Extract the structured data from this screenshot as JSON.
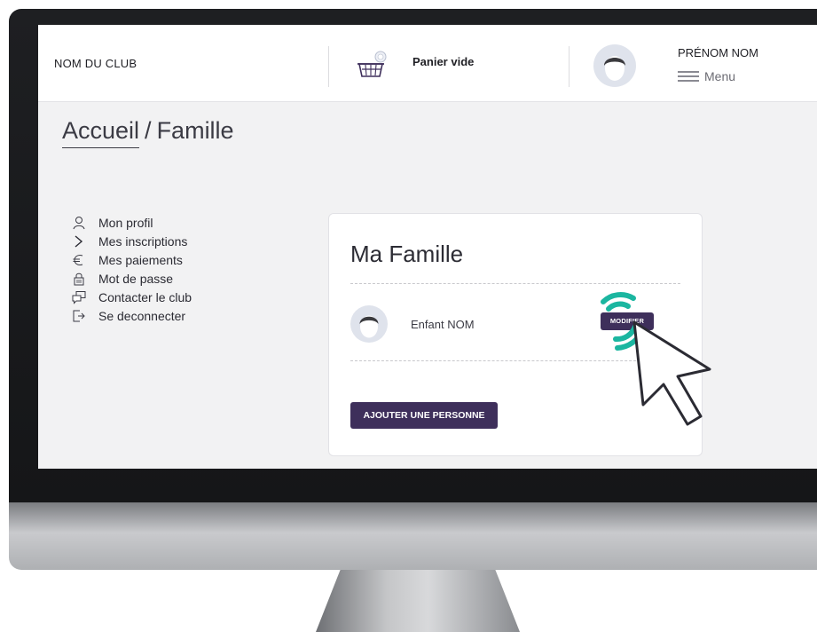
{
  "header": {
    "club_name": "NOM DU CLUB",
    "basket_label": "Panier vide",
    "user_name": "PRÉNOM NOM",
    "menu_label": "Menu"
  },
  "breadcrumb": {
    "home": "Accueil",
    "separator": "/",
    "current": "Famille"
  },
  "sidebar": {
    "items": [
      {
        "label": "Mon profil",
        "icon": "user-icon"
      },
      {
        "label": "Mes inscriptions",
        "icon": "chevron-right-icon"
      },
      {
        "label": "Mes paiements",
        "icon": "euro-icon"
      },
      {
        "label": "Mot de passe",
        "icon": "lock-icon"
      },
      {
        "label": "Contacter le club",
        "icon": "chat-icon"
      },
      {
        "label": "Se deconnecter",
        "icon": "logout-icon"
      }
    ]
  },
  "family": {
    "title": "Ma Famille",
    "members": [
      {
        "name": "Enfant NOM",
        "edit_label": "MODIFIER"
      }
    ],
    "add_label": "AJOUTER UNE PERSONNE"
  },
  "colors": {
    "accent": "#3e2f5b",
    "click_ring": "#1bb6a0"
  }
}
